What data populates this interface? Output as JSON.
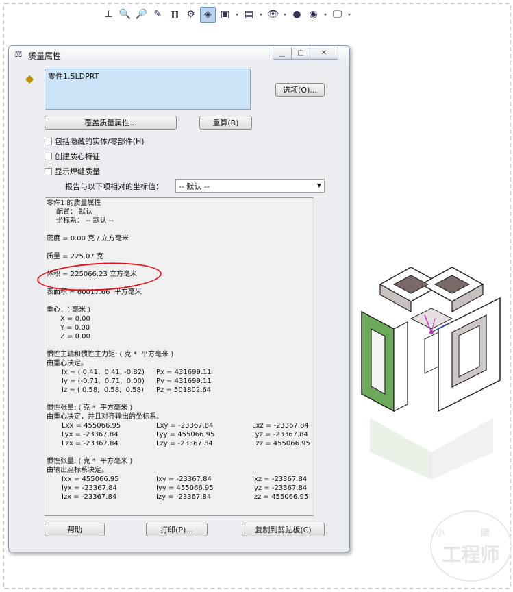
{
  "dialog": {
    "title": "质量属性",
    "selection": "零件1.SLDPRT",
    "buttons": {
      "options": "选项(O)...",
      "override": "覆盖质量属性...",
      "recalc": "重算(R)",
      "help": "帮助",
      "print": "打印(P)...",
      "copy": "复制到剪贴板(C)"
    },
    "checkboxes": [
      {
        "label": "包括隐藏的实体/零部件(H)",
        "checked": false
      },
      {
        "label": "创建质心特征",
        "checked": false
      },
      {
        "label": "显示焊缝质量",
        "checked": false
      }
    ],
    "coord_label": "报告与以下项相对的坐标值：",
    "coord_value": "-- 默认 --",
    "results": {
      "header": "零件1 的质量属性",
      "config": "配置： 默认",
      "coordsys": "坐标系： -- 默认 --",
      "density": "密度 = 0.00 克 / 立方毫米",
      "mass": "质量 = 225.07 克",
      "volume": "体积 = 225066.23 立方毫米",
      "area": "表面积 = 60017.66  平方毫米",
      "cog_title": "重心：( 毫米 )",
      "cog_x": "X = 0.00",
      "cog_y": "Y = 0.00",
      "cog_z": "Z = 0.00",
      "principal_title": "惯性主轴和惯性主力矩: ( 克 *  平方毫米 )",
      "principal_sub": "由重心决定。",
      "ix": "Ix = ( 0.41,  0.41, -0.82)",
      "iy": "Iy = (-0.71,  0.71,  0.00)",
      "iz": "Iz = ( 0.58,  0.58,  0.58)",
      "px": "Px = 431699.11",
      "py": "Py = 431699.11",
      "pz": "Pz = 501802.64",
      "tensor1_title": "惯性张量: ( 克 *  平方毫米 )",
      "tensor1_sub": "由重心决定，并且对齐输出的坐标系。",
      "t1": [
        [
          "Lxx = 455066.95",
          "Lxy = -23367.84",
          "Lxz = -23367.84"
        ],
        [
          "Lyx = -23367.84",
          "Lyy = 455066.95",
          "Lyz = -23367.84"
        ],
        [
          "Lzx = -23367.84",
          "Lzy = -23367.84",
          "Lzz = 455066.95"
        ]
      ],
      "tensor2_title": "惯性张量: ( 克 *  平方毫米 )",
      "tensor2_sub": "由输出座标系决定。",
      "t2": [
        [
          "Ixx = 455066.95",
          "Ixy = -23367.84",
          "Ixz = -23367.84"
        ],
        [
          "Iyx = -23367.84",
          "Iyy = 455066.95",
          "Iyz = -23367.84"
        ],
        [
          "Izx = -23367.84",
          "Izy = -23367.84",
          "Izz = 455066.95"
        ]
      ]
    }
  },
  "toolbar_icons": [
    "normal-to-icon",
    "zoom-fit-icon",
    "zoom-area-icon",
    "section-view-icon",
    "view-orient-icon",
    "display-style-icon",
    "isometric-icon",
    "hide-show-icon",
    "view-settings-icon",
    "appearance-icon",
    "scene-icon",
    "monitor-icon"
  ],
  "watermark": {
    "top": "小  國",
    "bottom": "工程师"
  }
}
